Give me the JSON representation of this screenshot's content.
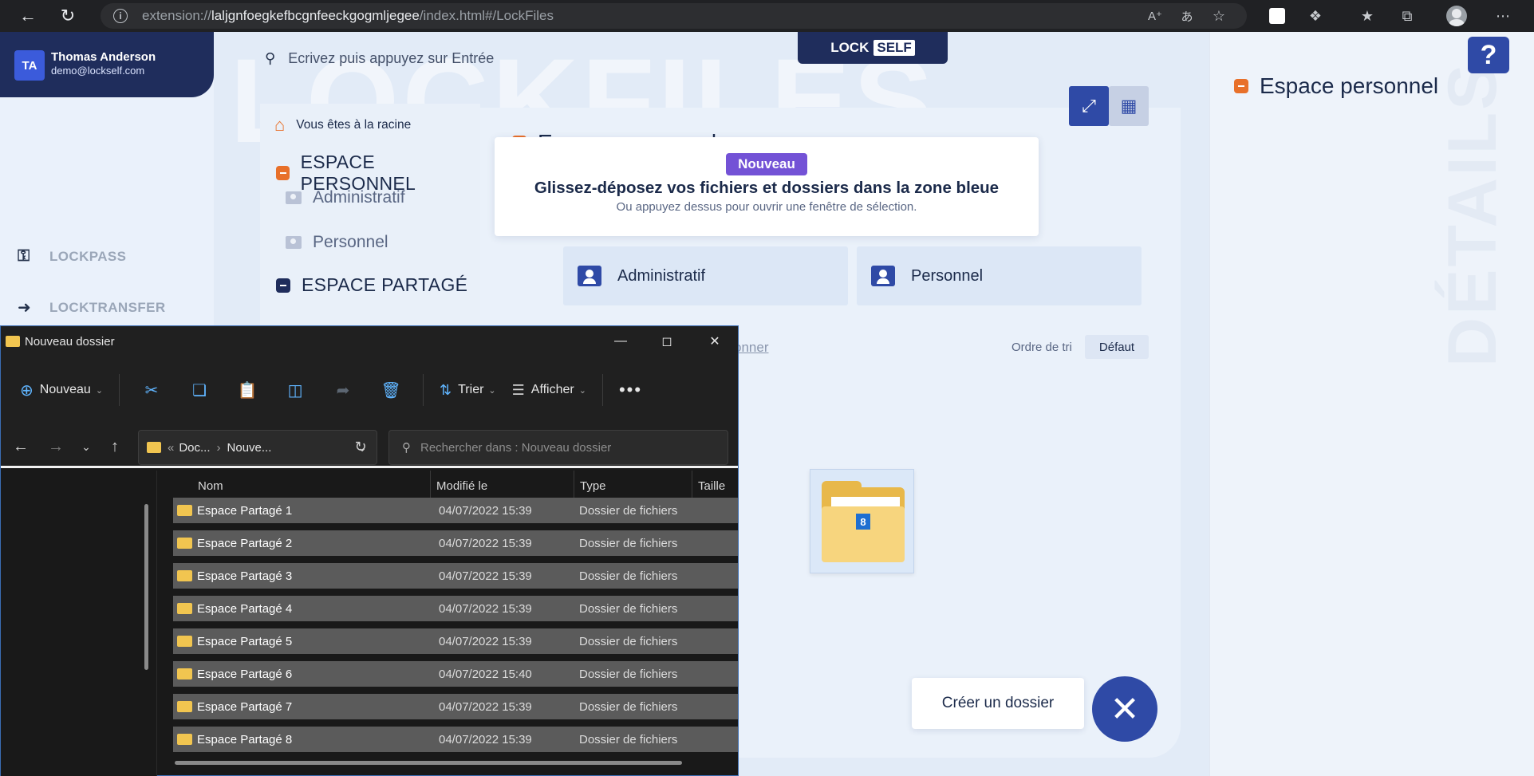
{
  "browser": {
    "url_prefix": "extension://",
    "url_domain": "laljgnfoegkefbcgnfeeckgogmljegee",
    "url_path": "/index.html#/LockFiles",
    "icons": [
      "back-icon",
      "refresh-icon",
      "info-icon",
      "read-aloud-icon",
      "translate-icon",
      "favorite-add-icon",
      "lockself-extension-icon",
      "extensions-icon",
      "favorites-icon",
      "collections-icon",
      "profile-icon",
      "more-icon"
    ]
  },
  "user": {
    "initials": "TA",
    "name": "Thomas Anderson",
    "email": "demo@lockself.com"
  },
  "nav": [
    {
      "label": "LOCKPASS",
      "icon": "key-icon"
    },
    {
      "label": "LOCKTRANSFER",
      "icon": "arrow-right-icon"
    }
  ],
  "logo": {
    "lock": "LOCK",
    "self": "SELF"
  },
  "watermark": "LOCKFILES",
  "search": {
    "placeholder": "Ecrivez puis appuyez sur Entrée"
  },
  "tree": {
    "root": "Vous êtes à la racine",
    "personal": "ESPACE PERSONNEL",
    "personal_items": [
      "Administratif",
      "Personnel"
    ],
    "shared": "ESPACE PARTAGÉ"
  },
  "panel": {
    "title": "Espace personnel"
  },
  "tooltip": {
    "badge": "Nouveau",
    "title": "Glissez-déposez vos fichiers et dossiers dans la zone bleue",
    "subtitle": "Ou appuyez dessus pour ouvrir une fenêtre de sélection."
  },
  "folders": [
    "Administratif",
    "Personnel"
  ],
  "partial_link": "onner",
  "sort": {
    "label": "Ordre de tri",
    "value": "Défaut"
  },
  "drag": {
    "count": "8"
  },
  "actions": {
    "create_folder": "Créer un dossier"
  },
  "details": {
    "title": "Espace personnel",
    "vertical": "DÉTAILS"
  },
  "explorer": {
    "title": "Nouveau dossier",
    "toolbar": {
      "new": "Nouveau",
      "sort": "Trier",
      "view": "Afficher"
    },
    "breadcrumb": [
      "Doc...",
      "Nouve..."
    ],
    "search_placeholder": "Rechercher dans : Nouveau dossier",
    "columns": [
      "Nom",
      "Modifié le",
      "Type",
      "Taille"
    ],
    "rows": [
      {
        "name": "Espace Partagé 1",
        "date": "04/07/2022 15:39",
        "type": "Dossier de fichiers"
      },
      {
        "name": "Espace Partagé 2",
        "date": "04/07/2022 15:39",
        "type": "Dossier de fichiers"
      },
      {
        "name": "Espace Partagé 3",
        "date": "04/07/2022 15:39",
        "type": "Dossier de fichiers"
      },
      {
        "name": "Espace Partagé 4",
        "date": "04/07/2022 15:39",
        "type": "Dossier de fichiers"
      },
      {
        "name": "Espace Partagé 5",
        "date": "04/07/2022 15:39",
        "type": "Dossier de fichiers"
      },
      {
        "name": "Espace Partagé 6",
        "date": "04/07/2022 15:40",
        "type": "Dossier de fichiers"
      },
      {
        "name": "Espace Partagé 7",
        "date": "04/07/2022 15:39",
        "type": "Dossier de fichiers"
      },
      {
        "name": "Espace Partagé 8",
        "date": "04/07/2022 15:39",
        "type": "Dossier de fichiers"
      }
    ]
  },
  "colors": {
    "brand_dark": "#1f2d5c",
    "brand_blue": "#2f4aa6",
    "accent_orange": "#e8702a",
    "badge_purple": "#7352d6"
  }
}
